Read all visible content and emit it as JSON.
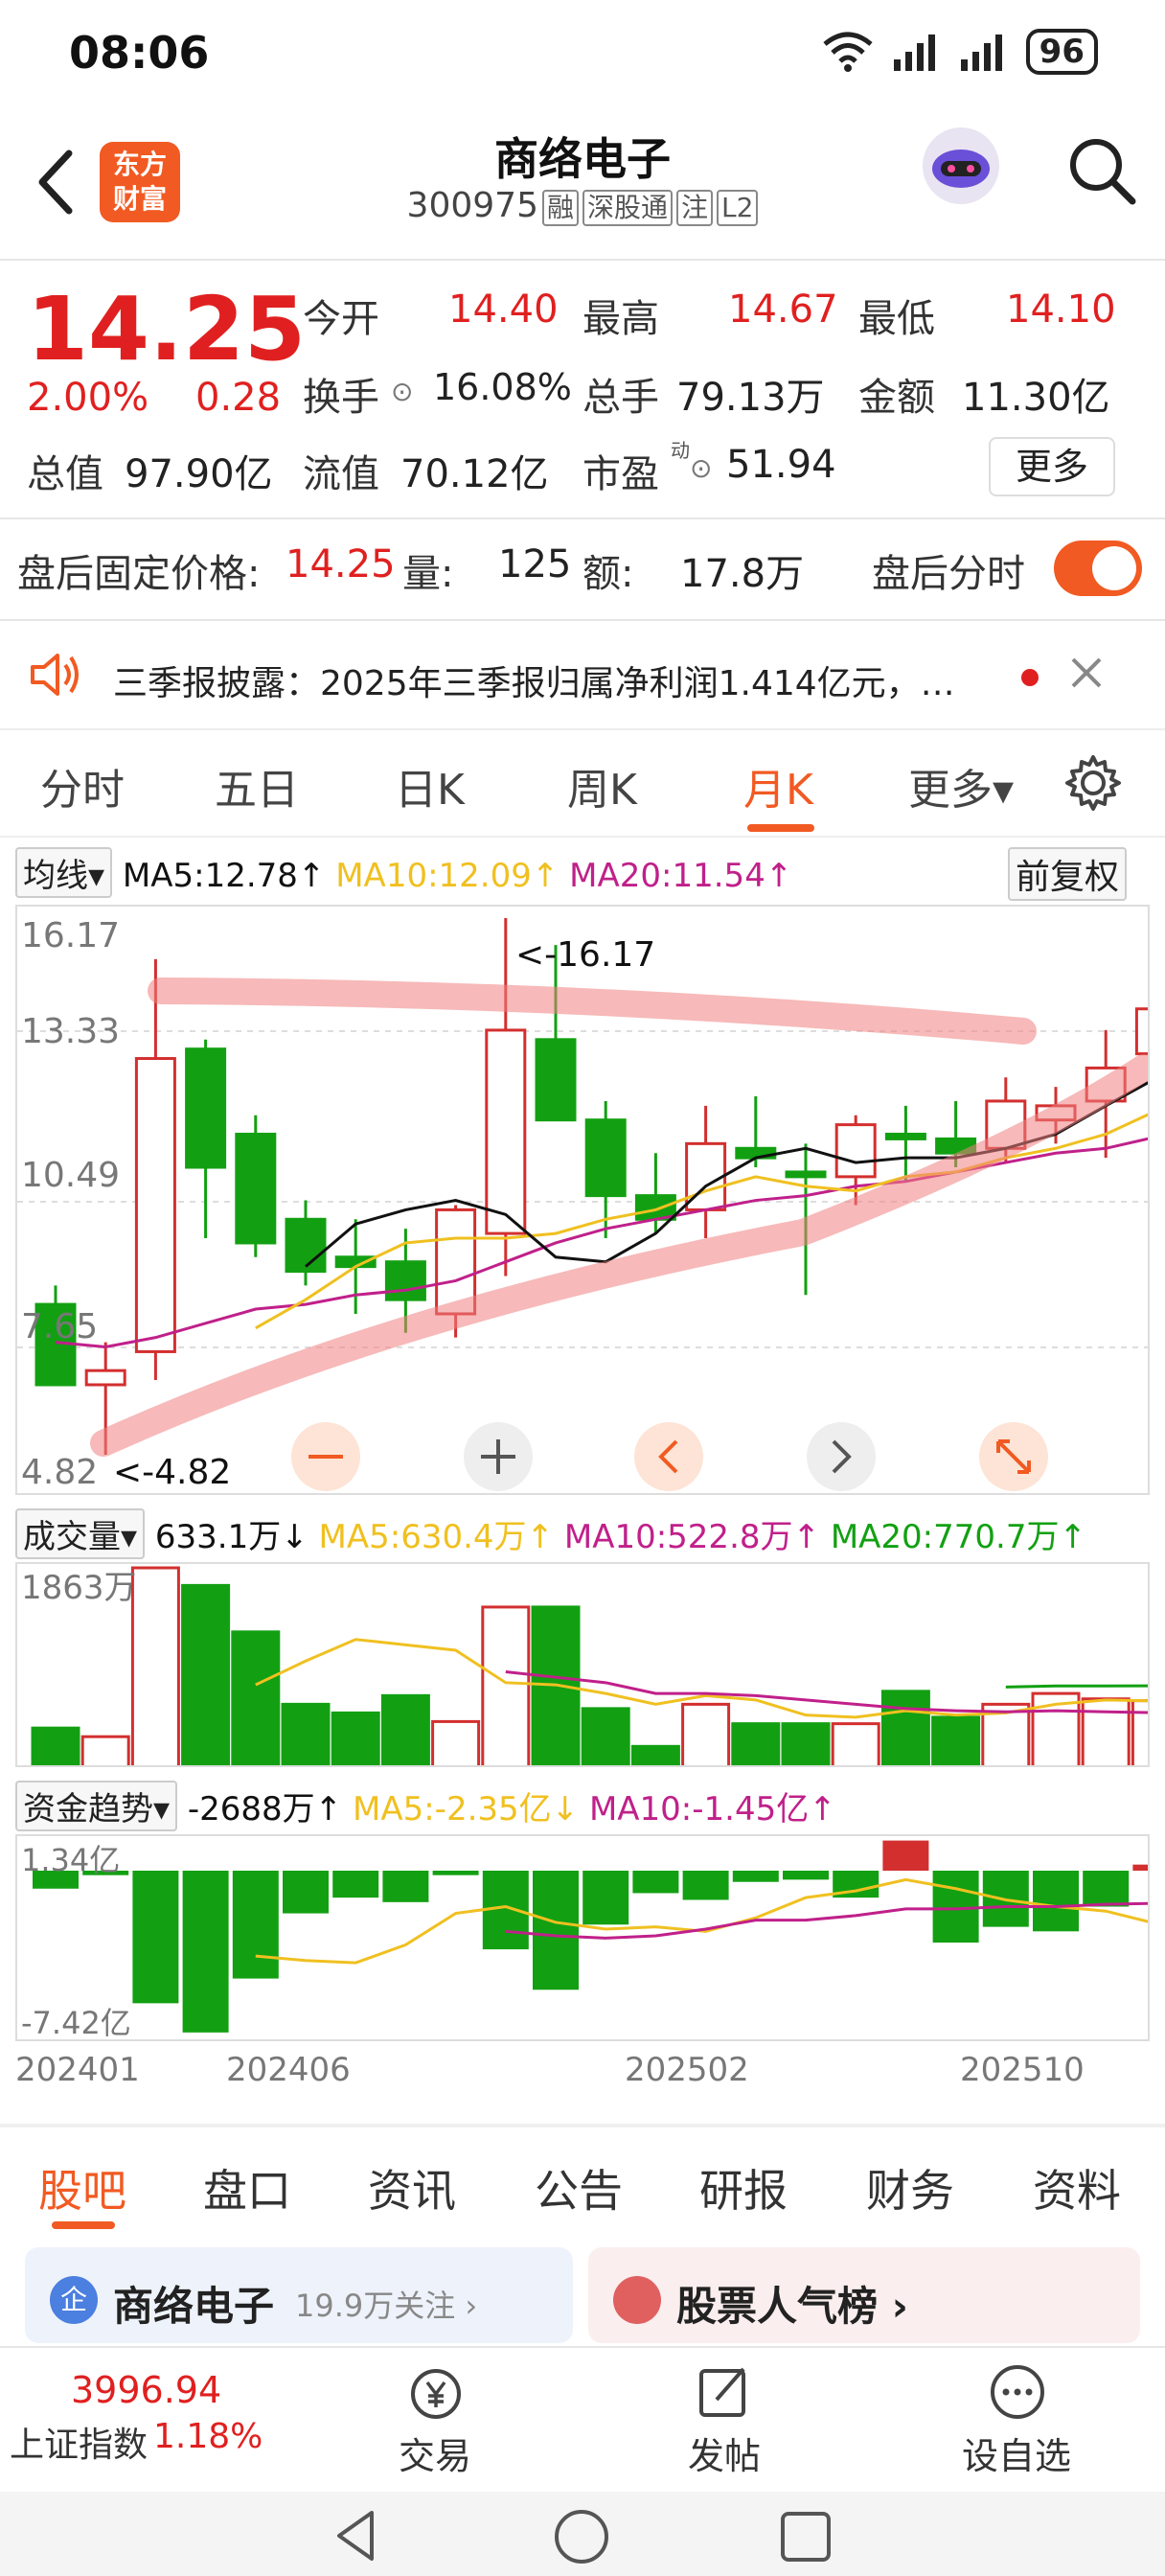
{
  "status": {
    "time": "08:06",
    "battery": "96"
  },
  "header": {
    "name": "商络电子",
    "code": "300975",
    "tags": [
      "融",
      "深股通",
      "注",
      "L2"
    ],
    "logo_lines": [
      "东方",
      "财富"
    ]
  },
  "quote": {
    "price": "14.25",
    "change_pct": "2.00%",
    "change": "0.28",
    "open_label": "今开",
    "open": "14.40",
    "high_label": "最高",
    "high": "14.67",
    "low_label": "最低",
    "low": "14.10",
    "turnover_label": "换手",
    "turnover": "16.08%",
    "volume_label": "总手",
    "volume": "79.13万",
    "amount_label": "金额",
    "amount": "11.30亿",
    "mcap_label": "总值",
    "mcap": "97.90亿",
    "float_label": "流值",
    "float": "70.12亿",
    "pe_label": "市盈",
    "pe_sup": "动",
    "pe": "51.94",
    "more": "更多"
  },
  "afterhours": {
    "label": "盘后固定价格:",
    "price": "14.25",
    "vol_label": "量:",
    "vol": "125",
    "amt_label": "额:",
    "amt": "17.8万",
    "switch_label": "盘后分时"
  },
  "notice": {
    "text": "三季报披露：2025年三季报归属净利润1.414亿元，…"
  },
  "tabs": [
    "分时",
    "五日",
    "日K",
    "周K",
    "月K",
    "更多▾"
  ],
  "active_tab": "月K",
  "kline": {
    "dropdown": "均线▾",
    "ma5": "MA5:12.78↑",
    "ma10": "MA10:12.09↑",
    "ma20": "MA20:11.54↑",
    "adjust": "前复权",
    "ytick": [
      "16.17",
      "13.33",
      "10.49",
      "7.65",
      "4.82"
    ],
    "max_label": "<-16.17",
    "min_label": "<-4.82",
    "colors": {
      "up": "#d32f2f",
      "down": "#12a012",
      "ma5": "#111111",
      "ma10": "#f0c020",
      "ma20": "#c0208a"
    }
  },
  "volume": {
    "dropdown": "成交量▾",
    "value": "633.1万↓",
    "ma5": "MA5:630.4万↑",
    "ma10": "MA10:522.8万↑",
    "ma20": "MA20:770.7万↑",
    "ytop": "1863万"
  },
  "fund": {
    "dropdown": "资金趋势▾",
    "value": "-2688万↑",
    "ma5": "MA5:-2.35亿↓",
    "ma10": "MA10:-1.45亿↑",
    "ytop": "1.34亿",
    "ybot": "-7.42亿"
  },
  "xlabels": [
    "202401",
    "202406",
    "202502",
    "202510"
  ],
  "chart_data": {
    "type": "candlestick",
    "categories": [
      "202401",
      "202402",
      "202403",
      "202404",
      "202405",
      "202406",
      "202407",
      "202408",
      "202409",
      "202410",
      "202411",
      "202412",
      "202501",
      "202502",
      "202503",
      "202504",
      "202505",
      "202506",
      "202507",
      "202508",
      "202509",
      "202510",
      "202511"
    ],
    "ohlc": [
      [
        8.0,
        8.4,
        6.3,
        6.3
      ],
      [
        6.3,
        7.2,
        4.82,
        6.6
      ],
      [
        7.0,
        15.3,
        6.4,
        13.2
      ],
      [
        13.4,
        13.6,
        9.4,
        10.9
      ],
      [
        11.6,
        12.0,
        9.0,
        9.3
      ],
      [
        9.8,
        10.2,
        8.4,
        8.7
      ],
      [
        9.0,
        9.8,
        7.8,
        8.8
      ],
      [
        8.9,
        9.6,
        7.4,
        8.1
      ],
      [
        7.8,
        10.1,
        7.3,
        10.0
      ],
      [
        9.5,
        16.17,
        8.6,
        13.8
      ],
      [
        13.6,
        15.6,
        12.3,
        11.9
      ],
      [
        11.9,
        12.3,
        9.4,
        10.3
      ],
      [
        10.3,
        11.2,
        9.5,
        9.8
      ],
      [
        10.0,
        12.2,
        9.4,
        11.4
      ],
      [
        11.3,
        12.4,
        10.9,
        11.1
      ],
      [
        10.8,
        11.4,
        8.2,
        10.7
      ],
      [
        10.7,
        12.0,
        10.1,
        11.8
      ],
      [
        11.6,
        12.2,
        10.6,
        11.5
      ],
      [
        11.5,
        12.3,
        10.9,
        11.2
      ],
      [
        11.3,
        12.8,
        11.0,
        12.3
      ],
      [
        11.9,
        12.6,
        11.4,
        12.2
      ],
      [
        12.3,
        13.8,
        11.1,
        13.0
      ],
      [
        13.3,
        14.67,
        12.9,
        14.25
      ]
    ],
    "ma5": [
      null,
      null,
      null,
      null,
      null,
      8.8,
      9.7,
      10.0,
      10.2,
      9.9,
      9.0,
      8.9,
      9.5,
      10.5,
      11.1,
      11.3,
      11.0,
      11.1,
      11.1,
      11.3,
      11.6,
      12.2,
      12.78
    ],
    "ma10": [
      null,
      null,
      null,
      null,
      7.5,
      8.1,
      8.8,
      9.3,
      9.4,
      9.4,
      9.5,
      9.8,
      10.0,
      10.4,
      10.7,
      10.5,
      10.4,
      10.7,
      10.8,
      11.1,
      11.3,
      11.6,
      12.09
    ],
    "ma20": [
      7.2,
      7.1,
      7.3,
      7.6,
      7.9,
      8.0,
      8.2,
      8.3,
      8.5,
      8.9,
      9.3,
      9.6,
      9.8,
      10.0,
      10.2,
      10.3,
      10.5,
      10.6,
      10.8,
      11.0,
      11.2,
      11.3,
      11.54
    ],
    "volume_wan": [
      380,
      300,
      1863,
      1700,
      1270,
      600,
      520,
      680,
      440,
      1500,
      1500,
      560,
      210,
      600,
      420,
      420,
      420,
      720,
      480,
      600,
      700,
      650,
      633.1
    ],
    "vol_ma5": [
      null,
      null,
      null,
      null,
      780,
      1000,
      1200,
      1150,
      1100,
      800,
      780,
      700,
      600,
      680,
      640,
      500,
      480,
      540,
      500,
      520,
      600,
      640,
      630.4
    ],
    "vol_ma10": [
      null,
      null,
      null,
      null,
      null,
      null,
      null,
      null,
      null,
      900,
      850,
      800,
      700,
      700,
      680,
      640,
      600,
      560,
      540,
      530,
      540,
      530,
      522.8
    ],
    "vol_ma20": [
      null,
      null,
      null,
      null,
      null,
      null,
      null,
      null,
      null,
      null,
      null,
      null,
      null,
      null,
      null,
      null,
      null,
      null,
      null,
      760,
      770,
      770,
      770.7
    ],
    "fund_yi": [
      -0.8,
      -0.2,
      -5.9,
      -7.2,
      -4.8,
      -1.9,
      -1.2,
      -1.4,
      -0.2,
      -3.5,
      -5.3,
      -2.4,
      -1.0,
      -1.3,
      -0.5,
      -0.4,
      -1.2,
      1.34,
      -3.2,
      -2.5,
      -2.7,
      -1.6,
      0.27
    ],
    "fund_ma5": [
      null,
      null,
      null,
      null,
      -3.8,
      -4.0,
      -4.1,
      -3.3,
      -1.9,
      -1.6,
      -2.3,
      -2.6,
      -2.5,
      -2.7,
      -2.1,
      -1.2,
      -0.9,
      -0.4,
      -0.8,
      -1.3,
      -1.6,
      -1.8,
      -2.35
    ],
    "fund_ma10": [
      null,
      null,
      null,
      null,
      null,
      null,
      null,
      null,
      null,
      -2.7,
      -2.9,
      -3.0,
      -2.9,
      -2.6,
      -2.2,
      -2.2,
      -2.0,
      -1.7,
      -1.7,
      -1.6,
      -1.6,
      -1.5,
      -1.45
    ]
  },
  "bottom_tabs": [
    "股吧",
    "盘口",
    "资讯",
    "公告",
    "研报",
    "财务",
    "资料"
  ],
  "cards": {
    "left_title": "商络电子",
    "left_sub": "19.9万关注 ›",
    "right_title": "股票人气榜 ›"
  },
  "footer": {
    "index_value": "3996.94",
    "index_name": "上证指数",
    "index_change": "1.18%",
    "trade": "交易",
    "post": "发帖",
    "watch": "设自选"
  }
}
